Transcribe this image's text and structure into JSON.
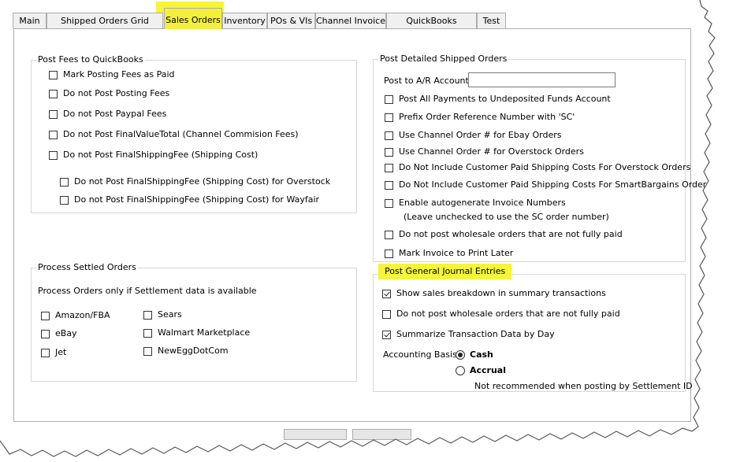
{
  "tabs": [
    {
      "id": "main",
      "label": "Main"
    },
    {
      "id": "shipped",
      "label": "Shipped Orders Grid Columns"
    },
    {
      "id": "sales",
      "label": "Sales Orders"
    },
    {
      "id": "inventory",
      "label": "Inventory"
    },
    {
      "id": "pos",
      "label": "POs & VIs"
    },
    {
      "id": "channel",
      "label": "Channel Invoice"
    },
    {
      "id": "qbfeatures",
      "label": "QuickBooks Features"
    },
    {
      "id": "test",
      "label": "Test"
    }
  ],
  "active_tab": "Sales Orders",
  "post_fees": {
    "title": "Post Fees to QuickBooks",
    "items": [
      {
        "label": "Mark Posting Fees as Paid",
        "checked": false
      },
      {
        "label": "Do not Post Posting Fees",
        "checked": false
      },
      {
        "label": "Do not Post Paypal Fees",
        "checked": false
      },
      {
        "label": "Do not Post FinalValueTotal (Channel Commision Fees)",
        "checked": false
      },
      {
        "label": "Do not Post FinalShippingFee (Shipping Cost)",
        "checked": false
      },
      {
        "label": "Do not Post FinalShippingFee (Shipping Cost) for Overstock",
        "checked": false
      },
      {
        "label": "Do not Post FinalShippingFee (Shipping Cost) for Wayfair",
        "checked": false
      }
    ]
  },
  "process_settled": {
    "title": "Process Settled Orders",
    "note": "Process Orders only if Settlement data is available",
    "items": [
      {
        "label": "Amazon/FBA",
        "checked": false
      },
      {
        "label": "eBay",
        "checked": false
      },
      {
        "label": "Jet",
        "checked": false
      },
      {
        "label": "Sears",
        "checked": false
      },
      {
        "label": "Walmart Marketplace",
        "checked": false
      },
      {
        "label": "NewEggDotCom",
        "checked": false
      }
    ]
  },
  "post_detailed": {
    "title": "Post Detailed Shipped Orders",
    "ar_account_label": "Post to A/R Account:",
    "ar_account_value": "",
    "items": [
      {
        "label": "Post All Payments to Undeposited Funds Account",
        "checked": false
      },
      {
        "label": "Prefix Order Reference Number with 'SC'",
        "checked": false
      },
      {
        "label": "Use Channel Order # for Ebay Orders",
        "checked": false
      },
      {
        "label": "Use Channel Order # for Overstock Orders",
        "checked": false
      },
      {
        "label": "Do Not Include Customer Paid Shipping Costs For Overstock Orders",
        "checked": false
      },
      {
        "label": "Do Not Include Customer Paid Shipping Costs For SmartBargains Orders",
        "checked": false
      },
      {
        "label": "Enable autogenerate Invoice Numbers",
        "checked": false
      },
      {
        "label": "Do not post wholesale orders that are not fully paid",
        "checked": false
      },
      {
        "label": "Mark Invoice to Print Later",
        "checked": false
      }
    ],
    "autogen_note": "(Leave unchecked to use the SC order number)"
  },
  "journal": {
    "title": "Post General Journal Entries",
    "items": [
      {
        "label": "Show sales breakdown in summary transactions",
        "checked": true
      },
      {
        "label": "Do not post wholesale orders that are not fully paid",
        "checked": false
      },
      {
        "label": "Summarize Transaction Data by Day",
        "checked": true
      }
    ],
    "basis_label": "Accounting Basis",
    "basis_options": [
      {
        "label": "Cash",
        "selected": true
      },
      {
        "label": "Accrual",
        "selected": false
      }
    ],
    "accrual_note": "Not recommended when posting by Settlement ID"
  },
  "colors": {
    "highlight": "#f5f53a",
    "border": "#adadad",
    "tab_bg": "#f0f0f0"
  }
}
